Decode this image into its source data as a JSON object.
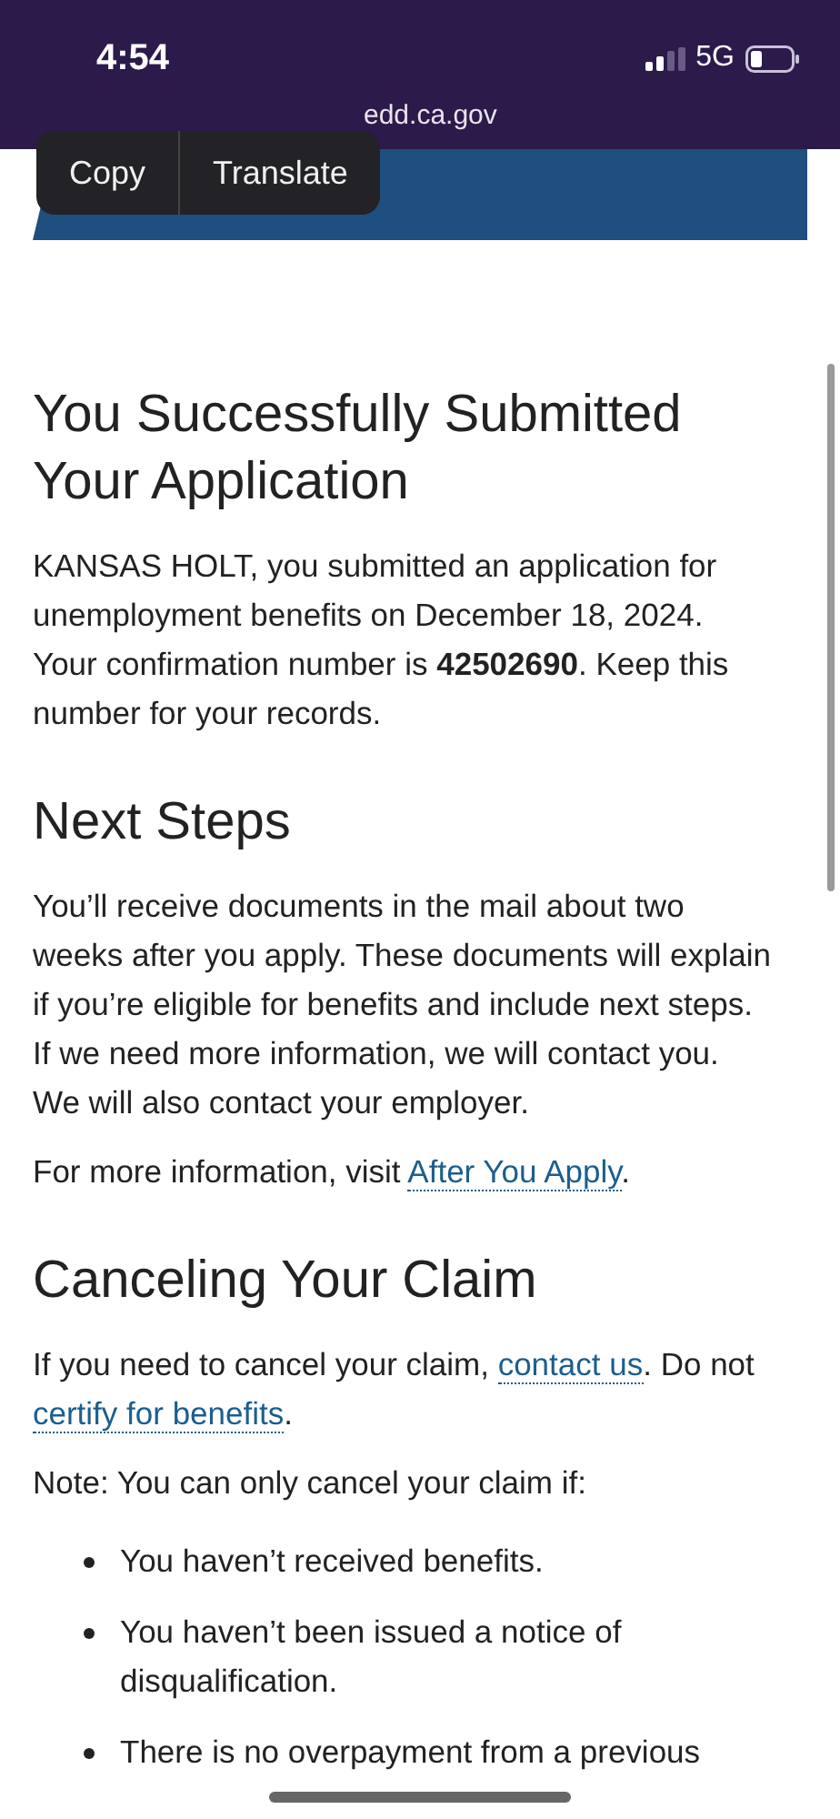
{
  "status_bar": {
    "time": "4:54",
    "network": "5G"
  },
  "address_bar": {
    "url": "edd.ca.gov"
  },
  "context_menu": {
    "items": [
      "Copy",
      "Translate"
    ]
  },
  "title": "You Successfully Submitted Your Application",
  "intro": "KANSAS HOLT, you submitted an application for unemployment benefits on December 18, 2024. Your confirmation number is **42502690**. Keep this number for your records.",
  "next_steps": {
    "heading": "Next Steps",
    "paragraph": "You’ll receive documents in the mail about two weeks after you apply. These documents will explain if you’re eligible for benefits and include next steps. If we need more information, we will contact you. We will also contact your employer.",
    "more_text": "For more information, visit ",
    "more_link": "After You Apply",
    "more_end": "."
  },
  "canceling": {
    "heading": "Canceling Your Claim",
    "p1_a": "If you need to cancel your claim, ",
    "p1_link1": "contact us",
    "p1_b": ". Do not ",
    "p1_link2": "certify for benefits",
    "p1_c": ".",
    "note": "Note: You can only cancel your claim if:",
    "bullets": [
      "You haven’t received benefits.",
      "You haven’t been issued a notice of disqualification.",
      "There is no overpayment from a previous"
    ]
  }
}
